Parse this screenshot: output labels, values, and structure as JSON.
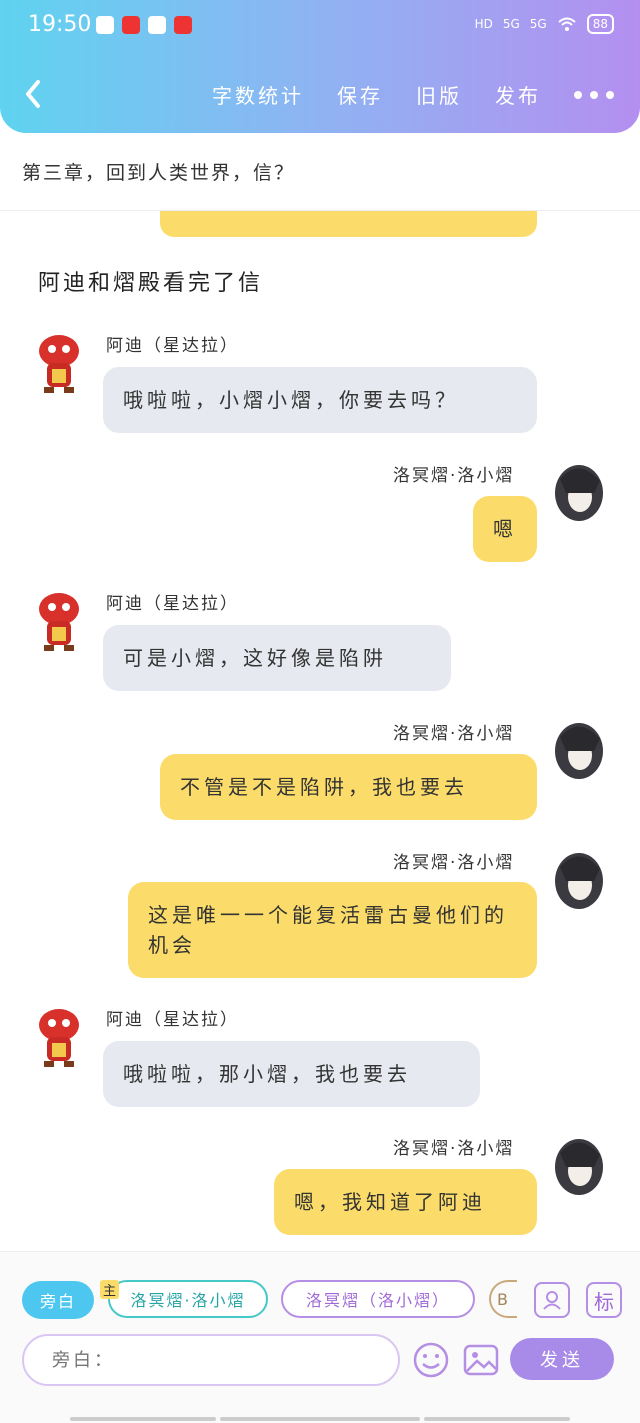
{
  "status": {
    "time": "19:50",
    "battery": "88",
    "net1": "5G",
    "net2": "5G",
    "hd": "HD"
  },
  "toolbar": {
    "word_count": "字数统计",
    "save": "保存",
    "old_version": "旧版",
    "publish": "发布"
  },
  "chapter_title": "第三章，回到人类世界，信？",
  "narration": "阿迪和熠殿看完了信",
  "messages": [
    {
      "sender": "阿迪（星达拉）",
      "text": "哦啦啦，小熠小熠，你要去吗？",
      "side": "left",
      "avatar": "red-dragon"
    },
    {
      "sender": "洛冥熠·洛小熠",
      "text": "嗯",
      "side": "right",
      "avatar": "dark-haired-boy"
    },
    {
      "sender": "阿迪（星达拉）",
      "text": "可是小熠，这好像是陷阱",
      "side": "left",
      "avatar": "red-dragon"
    },
    {
      "sender": "洛冥熠·洛小熠",
      "text": "不管是不是陷阱，我也要去",
      "side": "right",
      "avatar": "dark-haired-boy"
    },
    {
      "sender": "洛冥熠·洛小熠",
      "text": "这是唯一一个能复活雷古曼他们的机会",
      "side": "right",
      "avatar": "dark-haired-boy"
    },
    {
      "sender": "阿迪（星达拉）",
      "text": "哦啦啦，那小熠，我也要去",
      "side": "left",
      "avatar": "red-dragon"
    },
    {
      "sender": "洛冥熠·洛小熠",
      "text": "嗯，我知道了阿迪",
      "side": "right",
      "avatar": "dark-haired-boy"
    }
  ],
  "roles": {
    "narrator": "旁白",
    "main_badge": "主",
    "role1": "洛冥熠·洛小熠",
    "role2": "洛冥熠（洛小熠）",
    "role3_partial": "B"
  },
  "tools": {
    "mark": "标"
  },
  "input": {
    "placeholder": "旁白："
  },
  "send_label": "发送",
  "colors": {
    "header_start": "#5fd3f0",
    "header_end": "#b48ff0",
    "right_bubble": "#fbdc6a",
    "left_bubble": "#e6e9ef",
    "send": "#a88be8"
  }
}
